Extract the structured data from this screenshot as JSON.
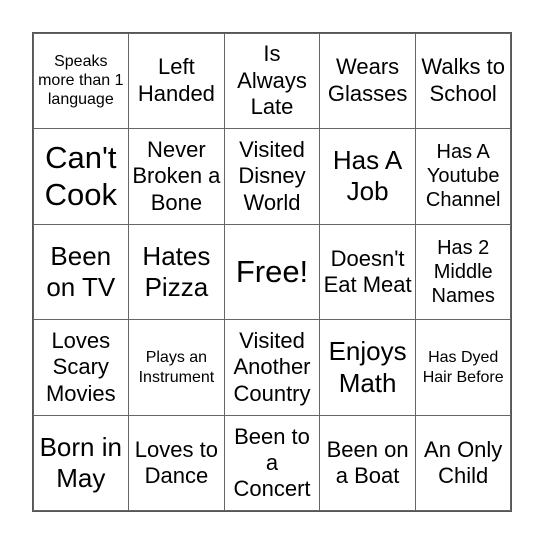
{
  "card": {
    "cells": [
      "Speaks more than 1 language",
      "Left Handed",
      "Is Always Late",
      "Wears Glasses",
      "Walks to School",
      "Can't Cook",
      "Never Broken a Bone",
      "Visited Disney World",
      "Has A Job",
      "Has A Youtube Channel",
      "Been on TV",
      "Hates Pizza",
      "Free!",
      "Doesn't Eat Meat",
      "Has 2 Middle Names",
      "Loves Scary Movies",
      "Plays an Instrument",
      "Visited Another Country",
      "Enjoys Math",
      "Has Dyed Hair Before",
      "Born in May",
      "Loves to Dance",
      "Been to a Concert",
      "Been on a Boat",
      "An Only Child"
    ]
  }
}
